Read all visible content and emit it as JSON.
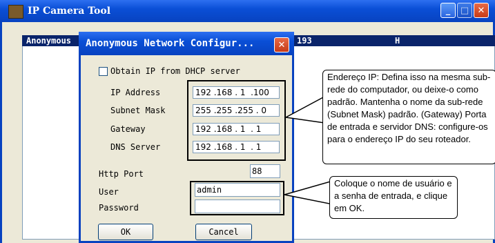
{
  "window": {
    "title": "IP Camera Tool",
    "min": "_",
    "max": "□",
    "close": "✕"
  },
  "list": {
    "col_name": "Anonymous",
    "col_ip": "193",
    "col_h": "H"
  },
  "dialog": {
    "title": "Anonymous Network Configur...",
    "close": "✕",
    "dhcp_label": "Obtain IP from DHCP server",
    "ip_label": "IP Address",
    "ip_value": "192 .168 . 1  .100",
    "mask_label": "Subnet Mask",
    "mask_value": "255 .255 .255 . 0",
    "gw_label": "Gateway",
    "gw_value": "192 .168 . 1  . 1",
    "dns_label": "DNS Server",
    "dns_value": "192 .168 . 1  . 1",
    "http_label": "Http Port",
    "http_value": "88",
    "user_label": "User",
    "user_value": "admin",
    "pass_label": "Password",
    "pass_value": "",
    "ok": "OK",
    "cancel": "Cancel"
  },
  "callouts": {
    "network": "Endereço IP: Defina isso na mesma sub-rede do computador, ou deixe-o como padrão. Mantenha o nome da sub-rede (Subnet Mask) padrão. (Gateway) Porta de entrada e servidor DNS: configure-os para o endereço IP do seu roteador.",
    "login": "Coloque o nome de usuário e a senha de entrada, e clique em OK."
  }
}
